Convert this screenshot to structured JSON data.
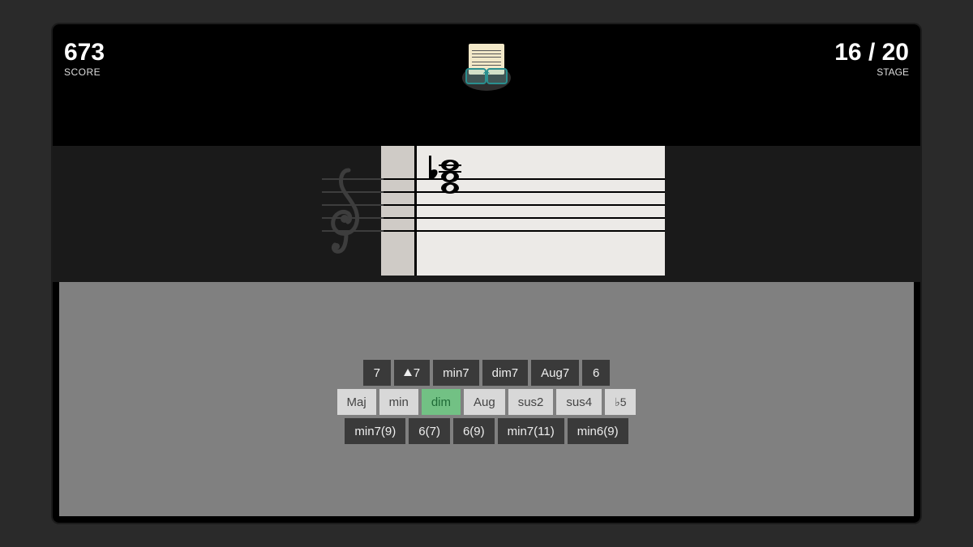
{
  "header": {
    "score_value": "673",
    "score_label": "SCORE",
    "stage_value": "16 / 20",
    "stage_label": "STAGE"
  },
  "notation": {
    "clef": "treble",
    "accidental": "flat",
    "chord_description": "stacked triad above staff"
  },
  "answers": {
    "row1": [
      "7",
      "△7",
      "min7",
      "dim7",
      "Aug7",
      "6"
    ],
    "row2": [
      "Maj",
      "min",
      "dim",
      "Aug",
      "sus2",
      "sus4",
      "♭5"
    ],
    "row3": [
      "min7(9)",
      "6(7)",
      "6(9)",
      "min7(11)",
      "min6(9)"
    ],
    "selected": "dim"
  }
}
